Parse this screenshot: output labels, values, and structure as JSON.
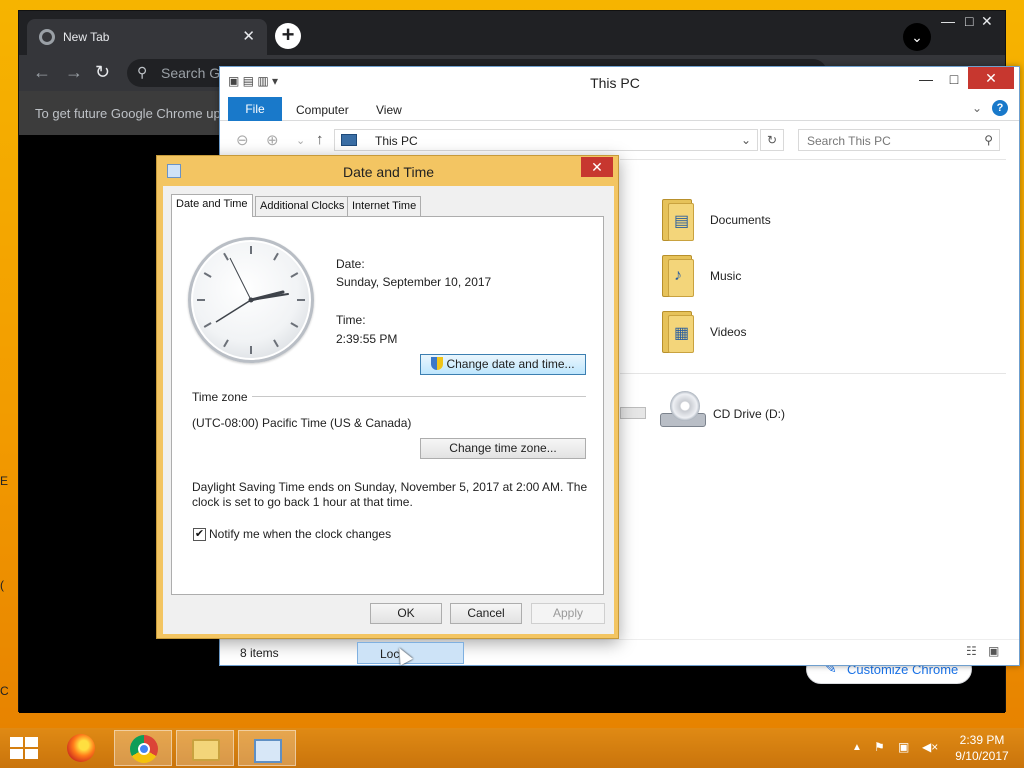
{
  "chrome": {
    "tab_title": "New Tab",
    "omnibox_placeholder": "Search Go",
    "infobar_text": "To get future Google Chrome up",
    "customize_label": "Customize Chrome"
  },
  "explorer": {
    "title": "This PC",
    "ribbon_file": "File",
    "ribbon_tabs": [
      "Computer",
      "View"
    ],
    "breadcrumb": "This PC",
    "search_placeholder": "Search This PC",
    "items": [
      "Documents",
      "Music",
      "Videos",
      "CD Drive (D:)"
    ],
    "status_count": "8 items"
  },
  "dialog": {
    "title": "Date and Time",
    "tabs": [
      "Date and Time",
      "Additional Clocks",
      "Internet Time"
    ],
    "date_label": "Date:",
    "date_value": "Sunday, September 10, 2017",
    "time_label": "Time:",
    "time_value": "2:39:55 PM",
    "change_datetime_label": "Change date and time...",
    "timezone_heading": "Time zone",
    "timezone_value": "(UTC-08:00) Pacific Time (US & Canada)",
    "change_timezone_label": "Change time zone...",
    "dst_line1": "Daylight Saving Time ends on Sunday, November 5, 2017 at 2:00 AM. The",
    "dst_line2": "clock is set to go back 1 hour at that time.",
    "notify_label": "Notify me when the clock changes",
    "notify_checked": true,
    "ok_label": "OK",
    "cancel_label": "Cancel",
    "apply_label": "Apply"
  },
  "ghost_item_label": "Loc",
  "taskbar": {
    "apps": [
      "firefox-icon",
      "chrome-icon",
      "file-explorer-icon",
      "date-time-icon"
    ],
    "clock_time": "2:39 PM",
    "clock_date": "9/10/2017"
  },
  "colors": {
    "desktop": "#f29a00",
    "dialog_frame": "#f3c562",
    "close_red": "#c7372f",
    "accent_blue": "#1979ca"
  }
}
